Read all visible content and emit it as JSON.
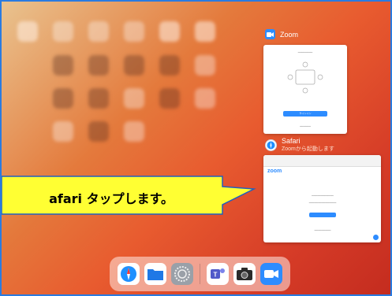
{
  "zoom_card": {
    "app_name": "Zoom",
    "button_label": "サインイン"
  },
  "safari_card": {
    "app_name": "Safari",
    "subtitle": "Zoomから起動します",
    "page_logo": "zoom"
  },
  "callout": {
    "text": "afari タップします。"
  },
  "dock": {
    "items": [
      "safari-icon",
      "files-icon",
      "settings-icon",
      "teams-icon",
      "camera-icon",
      "zoom-icon"
    ]
  },
  "colors": {
    "frame": "#2a7be0",
    "callout_fill": "#ffff33",
    "callout_border": "#2060c0",
    "zoom_blue": "#2d8cff"
  }
}
